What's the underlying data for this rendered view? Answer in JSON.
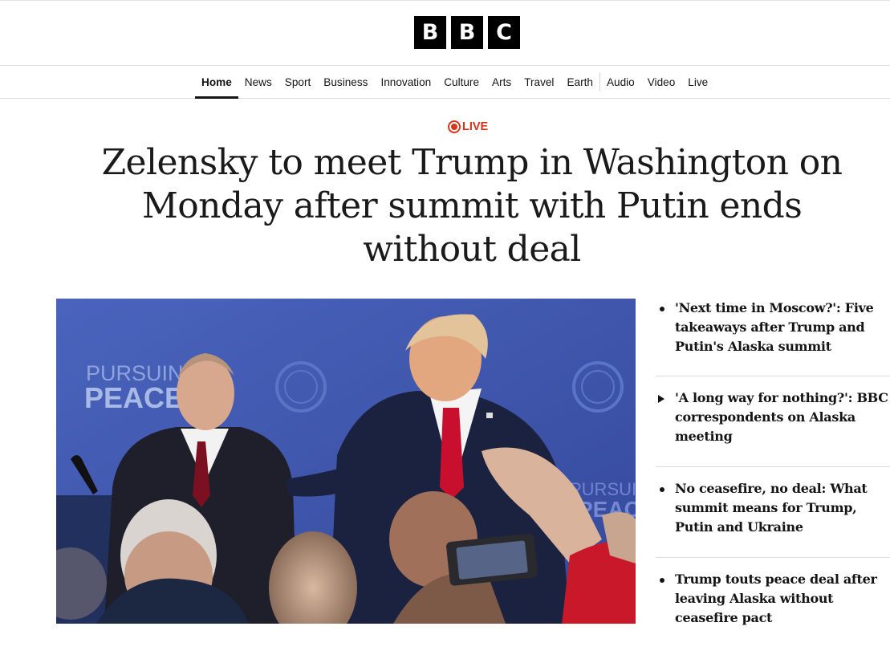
{
  "logo": {
    "letters": [
      "B",
      "B",
      "C"
    ]
  },
  "nav": {
    "items": [
      "Home",
      "News",
      "Sport",
      "Business",
      "Innovation",
      "Culture",
      "Arts",
      "Travel",
      "Earth",
      "Audio",
      "Video",
      "Live"
    ],
    "active": "Home"
  },
  "live_badge": "LIVE",
  "headline": "Zelensky to meet Trump in Washington on Monday after summit with Putin ends without deal",
  "hero_image": {
    "backdrop_text": [
      "PURSUING",
      "PEACE"
    ],
    "colors": {
      "backdrop": "#3e57ae",
      "tie_red": "#c8102e",
      "suit_navy": "#1b2240"
    }
  },
  "related": [
    {
      "icon": "bullet-dot-icon",
      "text": "'Next time in Moscow?': Five takeaways after Trump and Putin's Alaska summit"
    },
    {
      "icon": "play-triangle-icon",
      "text": "'A long way for nothing?': BBC correspondents on Alaska meeting"
    },
    {
      "icon": "bullet-dot-icon",
      "text": "No ceasefire, no deal: What summit means for Trump, Putin and Ukraine"
    },
    {
      "icon": "bullet-dot-icon",
      "text": "Trump touts peace deal after leaving Alaska without ceasefire pact"
    }
  ],
  "colors": {
    "accent_live": "#d4351c",
    "text": "#141414"
  }
}
